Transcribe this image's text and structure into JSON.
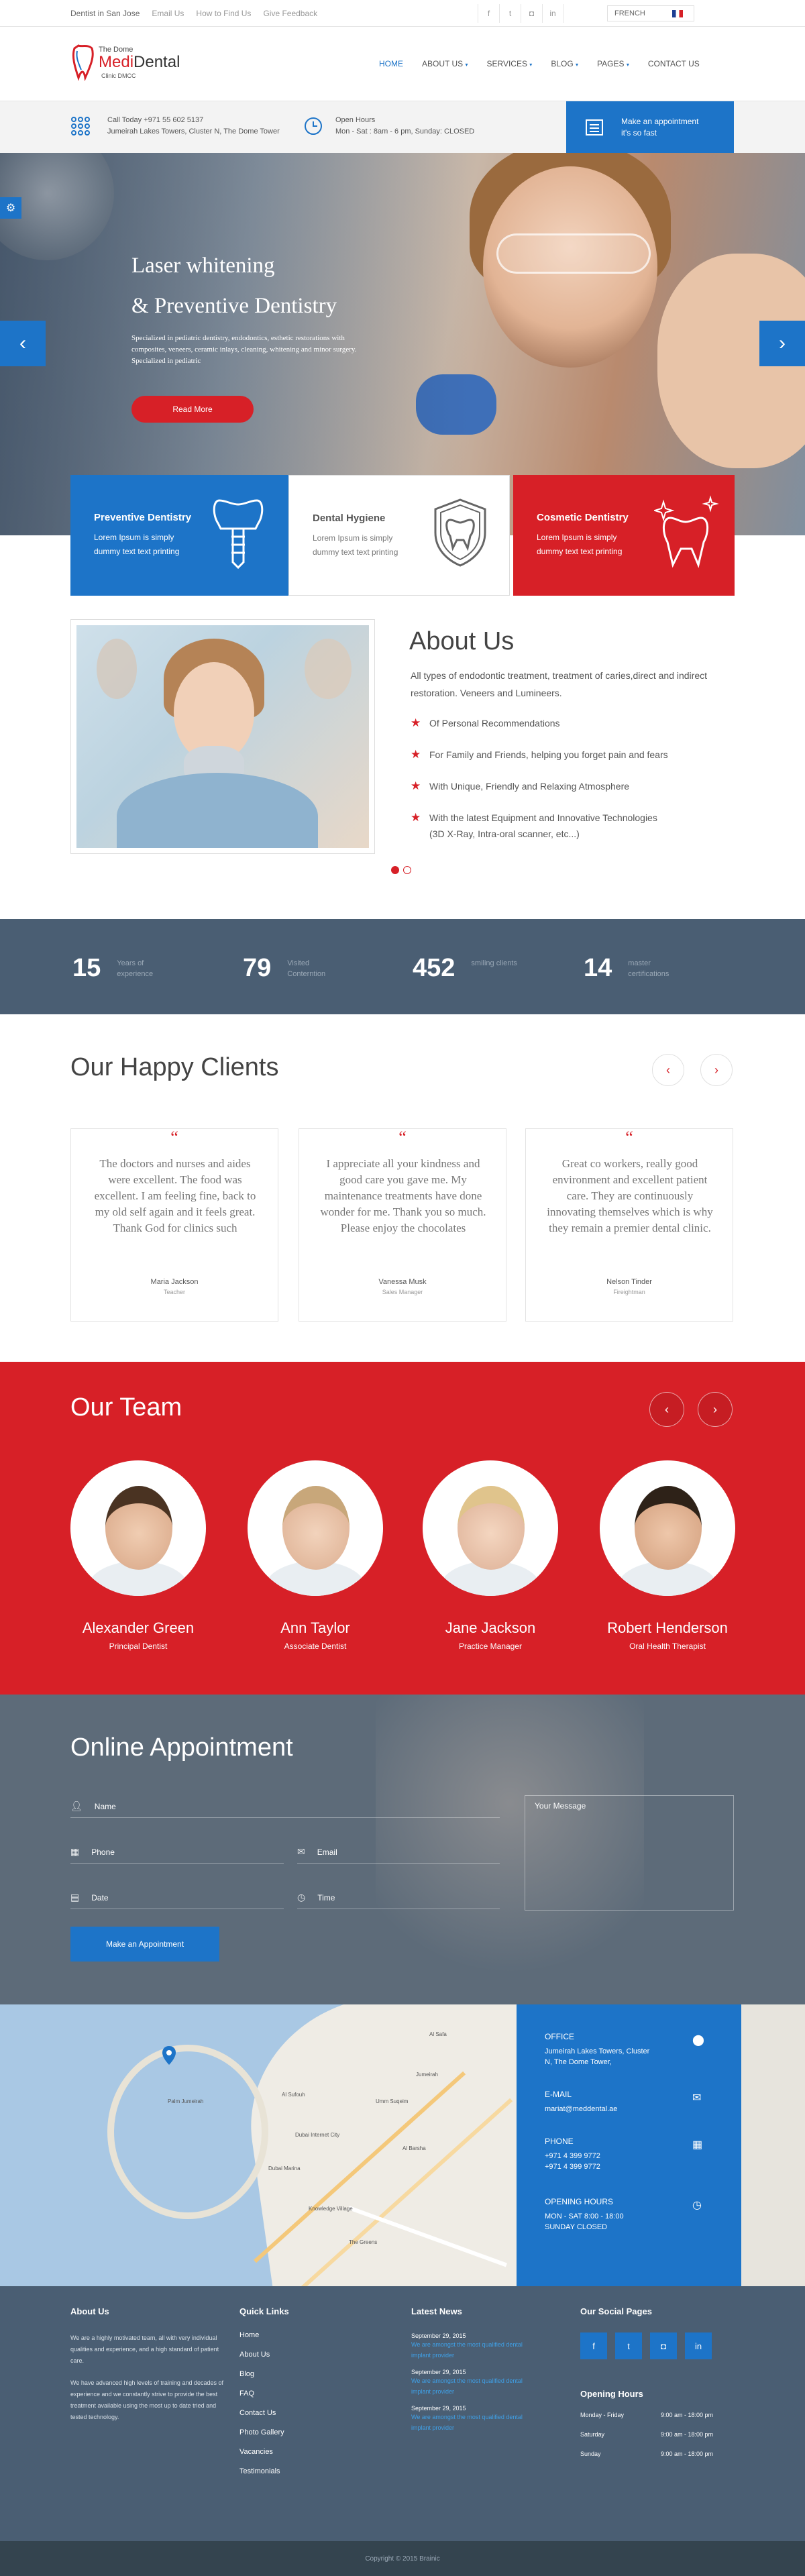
{
  "topbar": {
    "links": [
      "Dentist in San Jose",
      "Email Us",
      "How to Find Us",
      "Give Feedback"
    ],
    "social_icons": [
      "facebook-icon",
      "twitter-icon",
      "instagram-icon",
      "linkedin-icon"
    ],
    "language": "FRENCH"
  },
  "logo": {
    "line1": "The Dome",
    "brand_a": "Medi",
    "brand_b": "Dental",
    "line3": "Clinic DMCC"
  },
  "nav": [
    "HOME",
    "ABOUT US",
    "SERVICES",
    "BLOG",
    "PAGES",
    "CONTACT US"
  ],
  "info": {
    "call_label": "Call Today  +971 55 602 5137",
    "call_address": "Jumeirah Lakes Towers, Cluster N, The Dome Tower",
    "hours_label": "Open Hours",
    "hours_text": "Mon - Sat : 8am - 6 pm, Sunday: CLOSED",
    "appointment_title": "Make an appointment",
    "appointment_sub": "it's so fast"
  },
  "hero": {
    "title_1": "Laser whitening",
    "title_2": "& Preventive Dentistry",
    "text": "Specialized in pediatric dentistry, endodontics, esthetic restorations with composites, veneers, ceramic inlays, cleaning, whitening and minor surgery. Specialized in pediatric",
    "button": "Read More"
  },
  "features": [
    {
      "title": "Preventive Dentistry",
      "text": "Lorem Ipsum is simply dummy text text printing",
      "icon": "tooth-implant-icon"
    },
    {
      "title": "Dental Hygiene",
      "text": "Lorem Ipsum is simply dummy text text printing",
      "icon": "tooth-shield-icon"
    },
    {
      "title": "Cosmetic Dentistry",
      "text": "Lorem Ipsum is simply dummy text text printing",
      "icon": "sparkling-tooth-icon"
    }
  ],
  "about": {
    "title": "About Us",
    "lead": "All types of endodontic treatment, treatment of caries,direct and indirect restoration. Veneers and Lumineers.",
    "items": [
      "Of Personal Recommendations",
      "For Family and Friends, helping you forget pain and fears",
      "With Unique, Friendly and Relaxing Atmosphere",
      "With the latest Equipment and Innovative Technologies",
      "(3D X-Ray, Intra-oral scanner, etc...)"
    ]
  },
  "stats": [
    {
      "value": "15",
      "label": "Years of experience"
    },
    {
      "value": "79",
      "label": "Visited Conterntion"
    },
    {
      "value": "452",
      "label": "smiling clients"
    },
    {
      "value": "14",
      "label": "master certifications"
    }
  ],
  "clients": {
    "title": "Our Happy Clients",
    "items": [
      {
        "text": "The doctors and nurses and aides were excellent. The food was excellent. I am feeling fine, back to my old self again and it feels great. Thank God for clinics such",
        "name": "Maria Jackson",
        "role": "Teacher"
      },
      {
        "text": "I appreciate all your kindness and good care you gave me. My maintenance treatments have done wonder for me. Thank you so much. Please enjoy the chocolates",
        "name": "Vanessa Musk",
        "role": "Sales Manager"
      },
      {
        "text": "Great co workers, really good environment and excellent patient care. They are continuously innovating themselves which is why they remain a premier dental clinic.",
        "name": "Nelson Tinder",
        "role": "Fireightman"
      }
    ]
  },
  "team": {
    "title": "Our Team",
    "members": [
      {
        "name": "Alexander Green",
        "role": "Principal Dentist"
      },
      {
        "name": "Ann Taylor",
        "role": "Associate Dentist"
      },
      {
        "name": "Jane Jackson",
        "role": "Practice Manager"
      },
      {
        "name": "Robert Henderson",
        "role": "Oral Health Therapist"
      }
    ]
  },
  "appointment": {
    "title": "Online Appointment",
    "name_placeholder": "Name",
    "phone_placeholder": "Phone",
    "email_placeholder": "Email",
    "date_placeholder": "Date",
    "time_placeholder": "Time",
    "message_placeholder": "Your Message",
    "button": "Make an Appointment"
  },
  "contact": {
    "office_label": "OFFICE",
    "office_text": "Jumeirah Lakes Towers, Cluster N, The Dome Tower,",
    "email_label": "E-MAIL",
    "email_text": "mariat@meddental.ae",
    "phone_label": "PHONE",
    "phone_1": "+971 4 399 9772",
    "phone_2": "+971 4 399 9772",
    "hours_label": "OPENING HOURS",
    "hours_1": "MON - SAT 8:00 - 18:00",
    "hours_2": "SUNDAY CLOSED"
  },
  "map_labels": [
    "Palm Jumeirah",
    "Dubai Marina",
    "Al Barsha",
    "Jumeirah",
    "Al Safa",
    "Knowledge Village",
    "Umm Suqeim",
    "Dubai Internet City",
    "The Greens",
    "Al Sufouh"
  ],
  "footer": {
    "about_title": "About Us",
    "about_p1": "We are a highly motivated team, all with very individual qualities and experience, and a high standard of patient care.",
    "about_p2": "We have advanced high levels of training and decades of experience and we constantly strive to provide the best treatment available using the most up to date tried and tested technology.",
    "links_title": "Quick Links",
    "links": [
      "Home",
      "About Us",
      "Blog",
      "FAQ",
      "Contact Us",
      "Photo Gallery",
      "Vacancies",
      "Testimonials"
    ],
    "news_title": "Latest News",
    "news": [
      {
        "date": "September 29, 2015",
        "text": "We are amongst the most qualified dental implant provider"
      },
      {
        "date": "September 29, 2015",
        "text": "We are amongst the most qualified dental implant provider"
      },
      {
        "date": "September 29, 2015",
        "text": "We are amongst the most qualified dental implant provider"
      }
    ],
    "social_title": "Our Social Pages",
    "hours_title": "Opening Hours",
    "hours": [
      {
        "day": "Monday - Friday",
        "time": "9:00 am - 18:00 pm"
      },
      {
        "day": "Saturday",
        "time": "9:00 am - 18:00 pm"
      },
      {
        "day": "Sunday",
        "time": "9:00 am - 18:00 pm"
      }
    ]
  },
  "copyright": "Copyright © 2015 Brainic",
  "colors": {
    "primary": "#1d74c8",
    "accent": "#d72027",
    "dark": "#4a5e73"
  }
}
